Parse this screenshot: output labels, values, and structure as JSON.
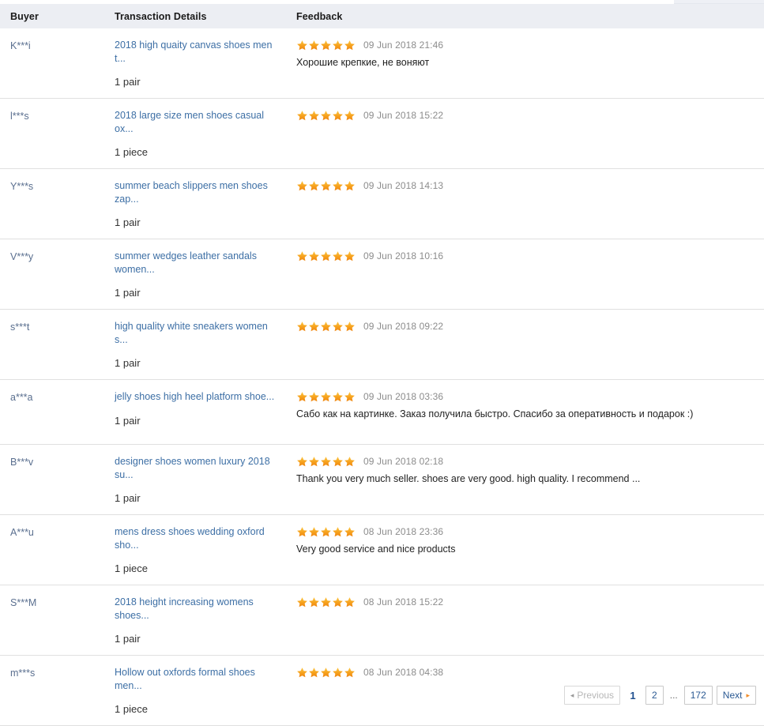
{
  "table": {
    "columns": {
      "buyer": "Buyer",
      "details": "Transaction Details",
      "feedback": "Feedback"
    },
    "rows": [
      {
        "buyer": "K***i",
        "product": "2018 high quaity canvas shoes men t...",
        "quantity": "1 pair",
        "stars": 5,
        "date": "09 Jun 2018 21:46",
        "comment": "Хорошие крепкие, не воняют"
      },
      {
        "buyer": "l***s",
        "product": "2018 large size men shoes casual ox...",
        "quantity": "1 piece",
        "stars": 5,
        "date": "09 Jun 2018 15:22",
        "comment": ""
      },
      {
        "buyer": "Y***s",
        "product": "summer beach slippers men shoes zap...",
        "quantity": "1 pair",
        "stars": 5,
        "date": "09 Jun 2018 14:13",
        "comment": ""
      },
      {
        "buyer": "V***y",
        "product": "summer wedges leather sandals women...",
        "quantity": "1 pair",
        "stars": 5,
        "date": "09 Jun 2018 10:16",
        "comment": ""
      },
      {
        "buyer": "s***t",
        "product": "high quality white sneakers women s...",
        "quantity": "1 pair",
        "stars": 5,
        "date": "09 Jun 2018 09:22",
        "comment": ""
      },
      {
        "buyer": "a***a",
        "product": "jelly shoes high heel platform shoe...",
        "quantity": "1 pair",
        "stars": 5,
        "date": "09 Jun 2018 03:36",
        "comment": "Сабо как на картинке. Заказ получила быстро. Спасибо за оперативность и подарок :)"
      },
      {
        "buyer": "B***v",
        "product": "designer shoes women luxury 2018 su...",
        "quantity": "1 pair",
        "stars": 5,
        "date": "09 Jun 2018 02:18",
        "comment": "Thank you very much seller. shoes are very good. high quality. I recommend ..."
      },
      {
        "buyer": "A***u",
        "product": "mens dress shoes wedding oxford sho...",
        "quantity": "1 piece",
        "stars": 5,
        "date": "08 Jun 2018 23:36",
        "comment": "Very good service and nice products"
      },
      {
        "buyer": "S***M",
        "product": "2018 height increasing womens shoes...",
        "quantity": "1 pair",
        "stars": 5,
        "date": "08 Jun 2018 15:22",
        "comment": ""
      },
      {
        "buyer": "m***s",
        "product": "Hollow out oxfords formal shoes men...",
        "quantity": "1 piece",
        "stars": 5,
        "date": "08 Jun 2018 04:38",
        "comment": ""
      }
    ]
  },
  "pagination": {
    "previous_label": "Previous",
    "next_label": "Next",
    "ellipsis": "...",
    "pages": [
      "1",
      "2"
    ],
    "last_page": "172",
    "current_page": "1",
    "previous_disabled": true
  },
  "colors": {
    "header_bg": "#eceef3",
    "link": "#3d6fa5",
    "buyer": "#5a6f8f",
    "star": "#f5a623",
    "date": "#8c8c8c",
    "next_arrow": "#f28c28"
  }
}
